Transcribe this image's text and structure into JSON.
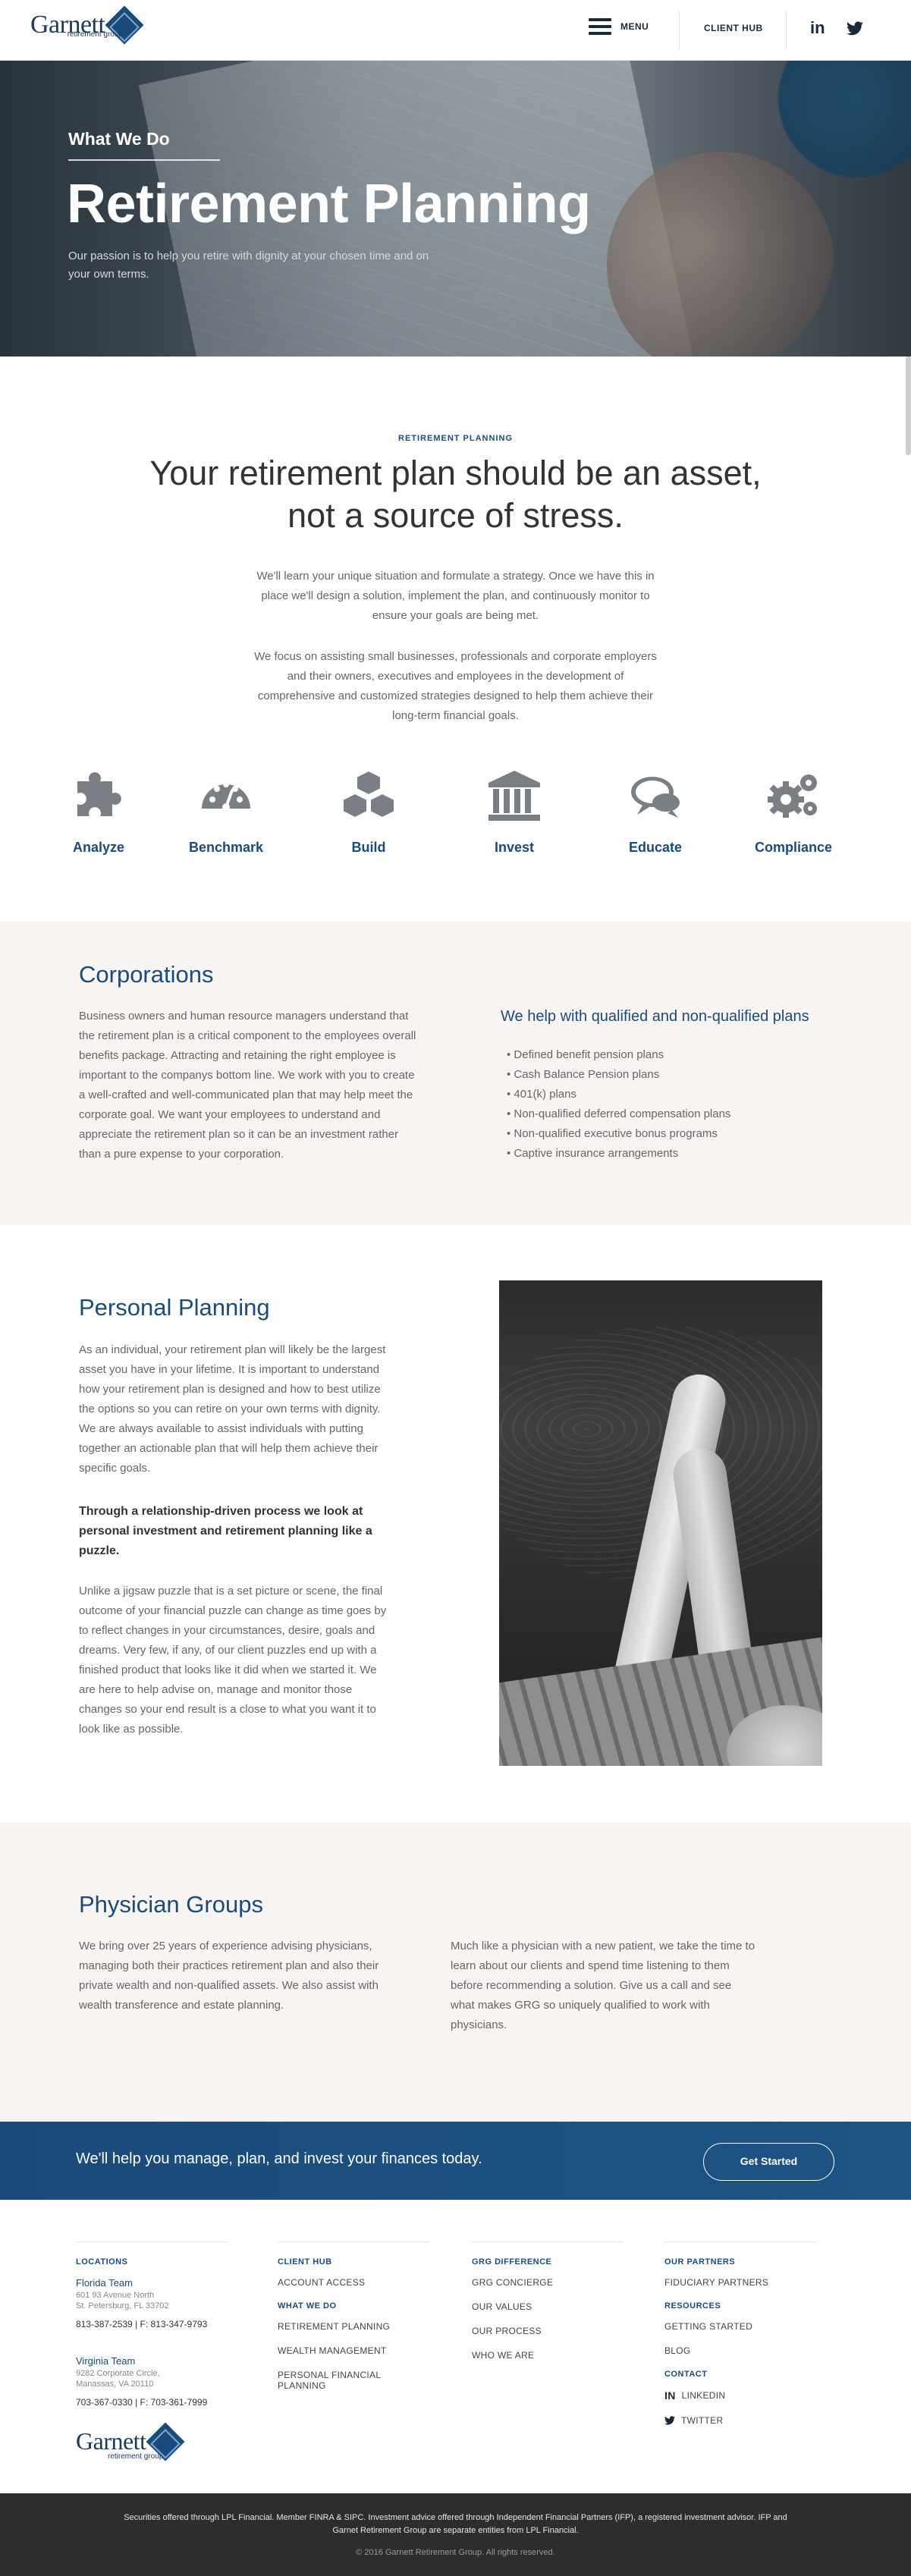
{
  "header": {
    "logo_text": "Garnett",
    "logo_sub": "retirement group",
    "menu_label": "MENU",
    "client_hub_label": "CLIENT HUB",
    "linkedin_glyph": "in"
  },
  "hero": {
    "kicker": "What We Do",
    "title": "Retirement Planning",
    "description": "Our passion is to help you retire with dignity at your chosen time and on your own terms."
  },
  "intro": {
    "kicker": "RETIREMENT PLANNING",
    "headline_line1": "Your retirement plan should be an asset,",
    "headline_line2": "not a source of stress.",
    "paragraph1": "We'll learn your unique situation and formulate a strategy. Once we have this in place we'll design a solution, implement the plan, and continuously monitor to ensure your goals are being met.",
    "paragraph2": "We focus on assisting small businesses, professionals and corporate employers and their owners, executives and employees in the development of comprehensive and customized strategies designed to help them achieve their long-term financial goals."
  },
  "services": [
    {
      "label": "Analyze",
      "icon": "puzzle-icon"
    },
    {
      "label": "Benchmark",
      "icon": "gauge-icon"
    },
    {
      "label": "Build",
      "icon": "cubes-icon"
    },
    {
      "label": "Invest",
      "icon": "bank-icon"
    },
    {
      "label": "Educate",
      "icon": "chat-icon"
    },
    {
      "label": "Compliance",
      "icon": "gears-icon"
    }
  ],
  "corporations": {
    "title": "Corporations",
    "body": "Business owners and human resource managers understand that the retirement plan is a critical component to the employees overall benefits package. Attracting and retaining the right employee is important to the companys bottom line. We work with you to create a well-crafted and well-communicated plan that may help meet the corporate goal. We want your employees to understand and appreciate the retirement plan so it can be an investment rather than a pure expense to your corporation.",
    "plans_title": "We help with qualified and non-qualified plans",
    "plans": [
      "Defined benefit pension plans",
      "Cash Balance Pension plans",
      "401(k) plans",
      "Non-qualified deferred compensation plans",
      "Non-qualified executive bonus programs",
      "Captive insurance arrangements"
    ]
  },
  "personal": {
    "title": "Personal Planning",
    "paragraph1": "As an individual, your retirement plan will likely be the largest asset you have in your lifetime. It is important to understand how your retirement plan is designed and how to best utilize the options so you can retire on your own terms with dignity. We are always available to assist individuals with putting together an actionable plan that will help them achieve their specific goals.",
    "bold": "Through a relationship-driven process we look at personal investment and retirement planning like a puzzle.",
    "paragraph2": "Unlike a jigsaw puzzle that is a set picture or scene, the final outcome of your financial puzzle can change as time goes by to reflect changes in your circumstances, desire, goals and dreams. Very few, if any, of our client puzzles end up with a finished product that looks like it did when we started it. We are here to help advise on, manage and monitor those changes so your end result is a close to what you want it to look like as possible."
  },
  "physician": {
    "title": "Physician Groups",
    "col1": "We bring over 25 years of experience advising physicians, managing both their practices retirement plan and also their private wealth and non-qualified assets. We also assist with wealth transference and estate planning.",
    "col2": "Much like a physician with a new patient, we take the time to learn about our clients and spend time listening to them before recommending a solution. Give us a call and see what makes GRG so uniquely qualified to work with physicians."
  },
  "cta": {
    "text": "We'll help you manage, plan, and invest your finances today.",
    "button": "Get Started"
  },
  "footer": {
    "locations": {
      "heading": "LOCATIONS",
      "florida": {
        "team": "Florida Team",
        "addr1": "601 93 Avenue North",
        "addr2": "St. Petersburg, FL 33702",
        "phone": "813-387-2539 | F: 813-347-9793"
      },
      "virginia": {
        "team": "Virginia Team",
        "addr1": "9282 Corporate Circle,",
        "addr2": "Manassas, VA 20110",
        "phone": "703-367-0330 | F: 703-361-7999"
      }
    },
    "col2": {
      "heading1": "CLIENT HUB",
      "link1": "ACCOUNT ACCESS",
      "heading2": "WHAT WE DO",
      "links": [
        "RETIREMENT PLANNING",
        "WEALTH MANAGEMENT",
        "PERSONAL FINANCIAL PLANNING"
      ]
    },
    "col3": {
      "heading": "GRG DIFFERENCE",
      "links": [
        "GRG CONCIERGE",
        "OUR VALUES",
        "OUR PROCESS",
        "WHO WE ARE"
      ]
    },
    "col4": {
      "heading1": "OUR PARTNERS",
      "link1": "FIDUCIARY PARTNERS",
      "heading2": "RESOURCES",
      "links": [
        "GETTING STARTED",
        "BLOG"
      ],
      "heading3": "CONTACT",
      "linkedin": "LINKEDIN",
      "twitter": "TWITTER"
    },
    "disclaimer": "Securities offered through LPL Financial. Member FINRA & SIPC. Investment advice offered through Independent Financial Partners (IFP), a registered investment advisor. IFP and Garnet Retirement Group are separate entities from LPL Financial.",
    "copyright": "© 2016 Garnett Retirement Group. All rights reserved."
  },
  "colors": {
    "accent": "#1b4b7a",
    "band": "#f7f4f2",
    "footer_bar": "#2d2d2d"
  }
}
